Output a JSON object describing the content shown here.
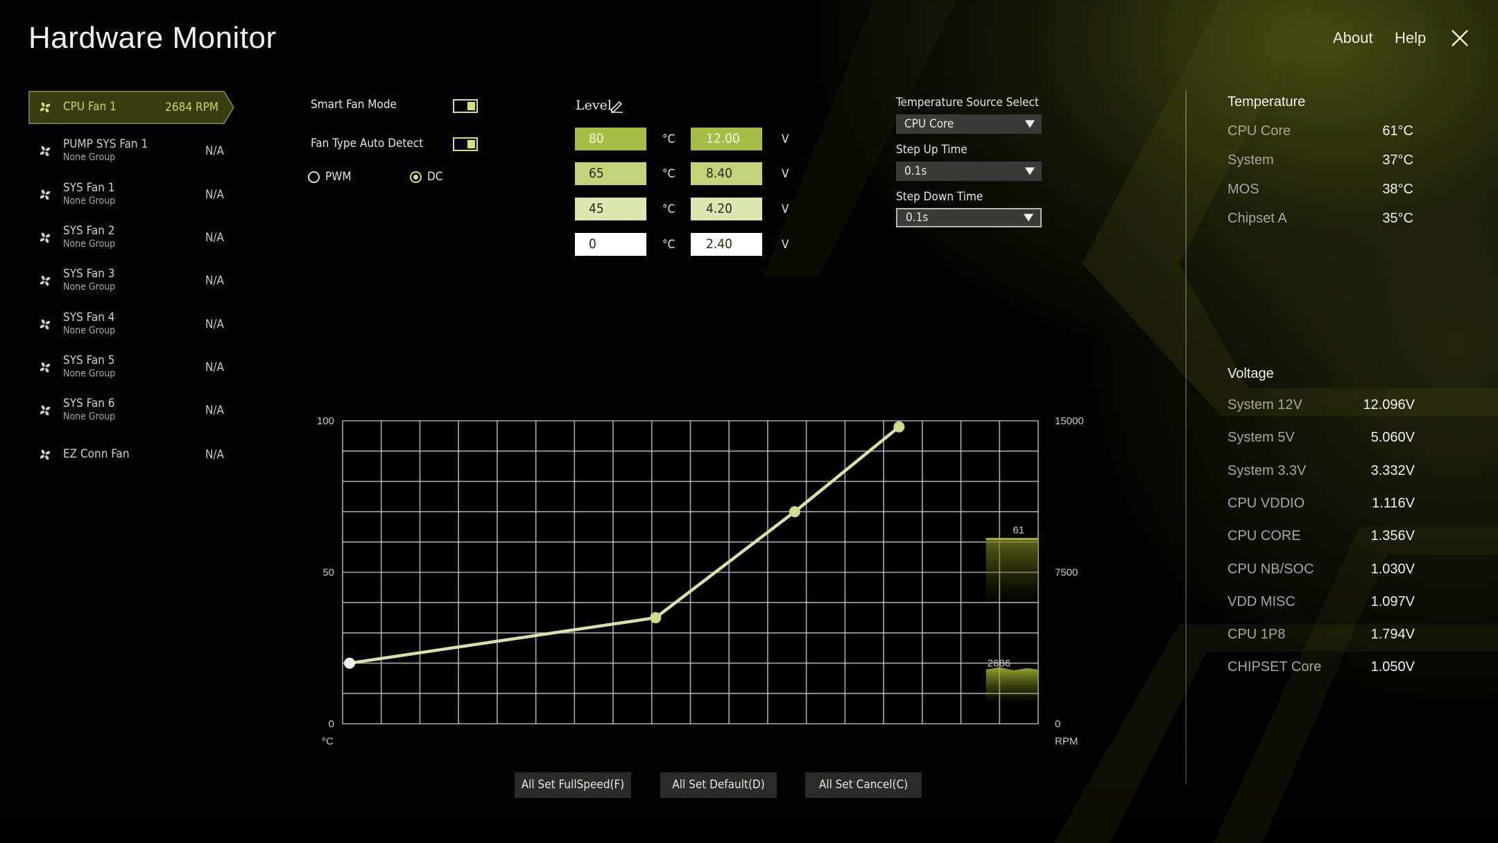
{
  "app": {
    "title": "Hardware Monitor",
    "about_label": "About",
    "help_label": "Help",
    "close_icon": "close-icon"
  },
  "sidebar": {
    "items": [
      {
        "name": "CPU Fan 1",
        "group": "",
        "value": "2684 RPM",
        "selected": true,
        "icon": "fan-icon"
      },
      {
        "name": "PUMP SYS Fan 1",
        "group": "None Group",
        "value": "N/A",
        "selected": false,
        "icon": "fan-icon"
      },
      {
        "name": "SYS Fan 1",
        "group": "None Group",
        "value": "N/A",
        "selected": false,
        "icon": "fan-icon"
      },
      {
        "name": "SYS Fan 2",
        "group": "None Group",
        "value": "N/A",
        "selected": false,
        "icon": "fan-icon"
      },
      {
        "name": "SYS Fan 3",
        "group": "None Group",
        "value": "N/A",
        "selected": false,
        "icon": "fan-icon"
      },
      {
        "name": "SYS Fan 4",
        "group": "None Group",
        "value": "N/A",
        "selected": false,
        "icon": "fan-icon"
      },
      {
        "name": "SYS Fan 5",
        "group": "None Group",
        "value": "N/A",
        "selected": false,
        "icon": "fan-icon"
      },
      {
        "name": "SYS Fan 6",
        "group": "None Group",
        "value": "N/A",
        "selected": false,
        "icon": "fan-icon"
      },
      {
        "name": "EZ Conn Fan",
        "group": "",
        "value": "N/A",
        "selected": false,
        "icon": "fan-icon"
      }
    ]
  },
  "controls": {
    "smart_fan_mode_label": "Smart Fan Mode",
    "smart_fan_mode_on": true,
    "fan_type_auto_detect_label": "Fan Type Auto Detect",
    "fan_type_auto_detect_on": true,
    "mode_options": [
      {
        "label": "PWM",
        "checked": false
      },
      {
        "label": "DC",
        "checked": true
      }
    ]
  },
  "levels": {
    "label": "Level",
    "edit_icon": "pencil-icon",
    "temp_unit": "°C",
    "volt_unit": "V",
    "rows": [
      {
        "temp": "80",
        "volt": "12.00",
        "color": "#a6bd46"
      },
      {
        "temp": "65",
        "volt": "8.40",
        "color": "#c2d37a"
      },
      {
        "temp": "45",
        "volt": "4.20",
        "color": "#dbe6b0"
      },
      {
        "temp": "0",
        "volt": "2.40",
        "color": "#ffffff"
      }
    ]
  },
  "settings": {
    "temp_source_label": "Temperature Source Select",
    "temp_source_value": "CPU Core",
    "step_up_label": "Step Up Time",
    "step_up_value": "0.1s",
    "step_down_label": "Step Down Time",
    "step_down_value": "0.1s"
  },
  "monitor": {
    "temperature_title": "Temperature",
    "temperatures": [
      {
        "name": "CPU Core",
        "value": "61°C"
      },
      {
        "name": "System",
        "value": "37°C"
      },
      {
        "name": "MOS",
        "value": "38°C"
      },
      {
        "name": "Chipset A",
        "value": "35°C"
      }
    ],
    "voltage_title": "Voltage",
    "voltages": [
      {
        "name": "System 12V",
        "value": "12.096V"
      },
      {
        "name": "System 5V",
        "value": "5.060V"
      },
      {
        "name": "System 3.3V",
        "value": "3.332V"
      },
      {
        "name": "CPU VDDIO",
        "value": "1.116V"
      },
      {
        "name": "CPU CORE",
        "value": "1.356V"
      },
      {
        "name": "CPU NB/SOC",
        "value": "1.030V"
      },
      {
        "name": "VDD MISC",
        "value": "1.097V"
      },
      {
        "name": "CPU 1P8",
        "value": "1.794V"
      },
      {
        "name": "CHIPSET Core",
        "value": "1.050V"
      }
    ]
  },
  "buttons": {
    "full_speed": "All Set FullSpeed(F)",
    "default": "All Set Default(D)",
    "cancel": "All Set Cancel(C)"
  },
  "colors": {
    "accent": "#d6e07a",
    "accent_dark": "#3a3d10",
    "curve": "#d8e2a6",
    "grid": "#c8c8c8"
  },
  "chart_data": {
    "type": "line",
    "title": "",
    "xlabel": "°C",
    "ylabel": "",
    "y2label": "RPM",
    "xlim": [
      0,
      100
    ],
    "ylim": [
      0,
      100
    ],
    "y2lim": [
      0,
      15000
    ],
    "left_ticks": [
      "100",
      "50",
      "0"
    ],
    "right_ticks": [
      "15000",
      "7500",
      "0"
    ],
    "grid": true,
    "grid_columns": 18,
    "grid_rows": 10,
    "series": [
      {
        "name": "fan-curve",
        "x": [
          1,
          45,
          65,
          80
        ],
        "y": [
          20,
          35,
          70,
          98
        ]
      }
    ],
    "realtime": {
      "temperature": 61,
      "temperature_label": "61",
      "rpm": 2686,
      "rpm_label": "2686"
    }
  }
}
